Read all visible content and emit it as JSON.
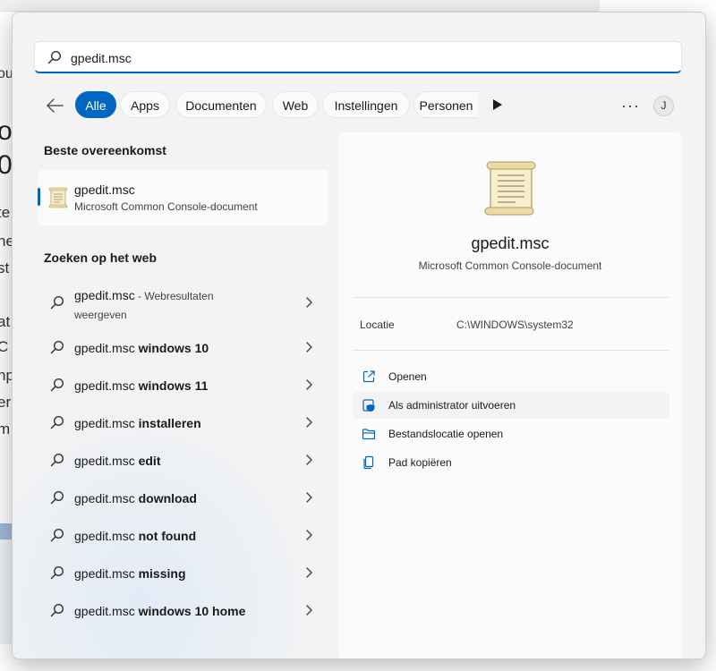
{
  "background": {
    "fragments": [
      "ou",
      "ol",
      "0",
      "te",
      "ne",
      "st",
      "at",
      "C",
      "np",
      "er",
      "m"
    ]
  },
  "search": {
    "value": "gpedit.msc"
  },
  "filters": {
    "tabs": [
      {
        "label": "Alle",
        "active": true
      },
      {
        "label": "Apps"
      },
      {
        "label": "Documenten"
      },
      {
        "label": "Web"
      },
      {
        "label": "Instellingen"
      },
      {
        "label": "Personen"
      }
    ],
    "more": "···",
    "avatar_initial": "J"
  },
  "best_match": {
    "title": "Beste overeenkomst",
    "name": "gpedit.msc",
    "type": "Microsoft Common Console-document"
  },
  "web": {
    "title": "Zoeken op het web",
    "first": {
      "query": "gpedit.msc",
      "suffix": " - Webresultaten",
      "suffix2": "weergeven"
    },
    "items": [
      {
        "prefix": "gpedit.msc ",
        "bold": "windows 10"
      },
      {
        "prefix": "gpedit.msc ",
        "bold": "windows 11"
      },
      {
        "prefix": "gpedit.msc ",
        "bold": "installeren"
      },
      {
        "prefix": "gpedit.msc ",
        "bold": "edit"
      },
      {
        "prefix": "gpedit.msc ",
        "bold": "download"
      },
      {
        "prefix": "gpedit.msc ",
        "bold": "not found"
      },
      {
        "prefix": "gpedit.msc ",
        "bold": "missing"
      },
      {
        "prefix": "gpedit.msc ",
        "bold": "windows 10 home"
      }
    ]
  },
  "preview": {
    "name": "gpedit.msc",
    "type": "Microsoft Common Console-document",
    "location_label": "Locatie",
    "location_value": "C:\\WINDOWS\\system32",
    "actions": [
      {
        "label": "Openen",
        "icon": "open-external-icon"
      },
      {
        "label": "Als administrator uitvoeren",
        "icon": "shield-icon"
      },
      {
        "label": "Bestandslocatie openen",
        "icon": "folder-icon"
      },
      {
        "label": "Pad kopiëren",
        "icon": "copy-icon"
      }
    ]
  },
  "colors": {
    "accent": "#0067c0",
    "panel_bg": "#f3f3f3",
    "card_bg": "#fbfbfb"
  }
}
